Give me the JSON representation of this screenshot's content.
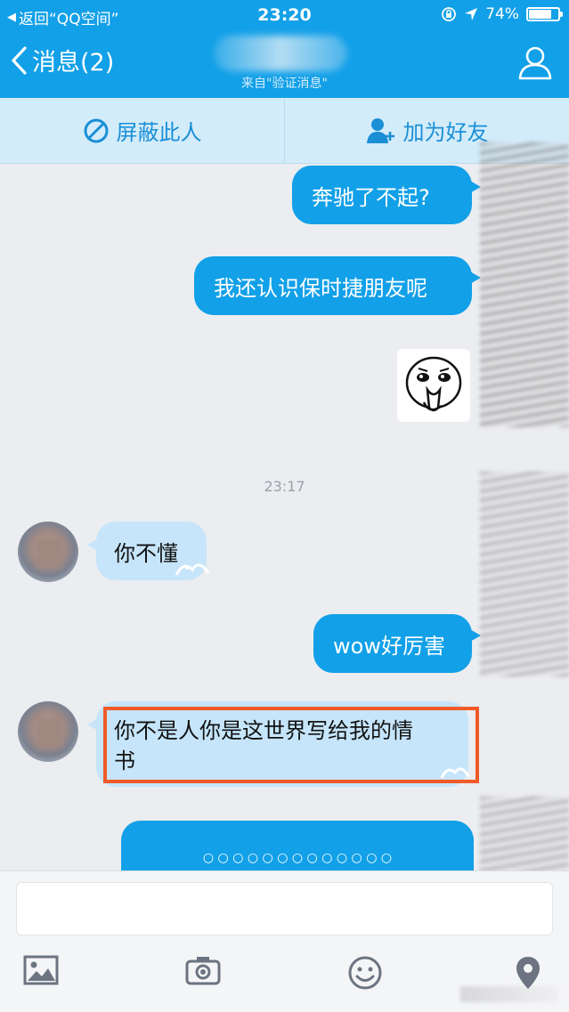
{
  "status_bar": {
    "back_app": "返回“QQ空间”",
    "time": "23:20",
    "battery": "74%",
    "battery_level": 0.74
  },
  "nav": {
    "back_label": "消息(2)",
    "subtitle": "来自\"验证消息\""
  },
  "actions": {
    "block_label": "屏蔽此人",
    "add_friend_label": "加为好友"
  },
  "messages": {
    "m1": "奔驰了不起?",
    "m2": "我还认识保时捷朋友呢",
    "time_divider": "23:17",
    "m3": "你不懂",
    "m4": "wow好厉害",
    "m5_line1": "你不是人你是这世界写给我的情",
    "m5_line2": "书",
    "m6_dots": "○ ○ ○ ○ ○ ○ ○ ○ ○ ○ ○ ○ ○"
  },
  "toolbar": {
    "icons": [
      "image-icon",
      "camera-icon",
      "emoji-icon",
      "location-icon"
    ]
  },
  "colors": {
    "brand_blue": "#12a0e8",
    "incoming_bubble": "#c6e5fa",
    "highlight": "#f05a28"
  }
}
